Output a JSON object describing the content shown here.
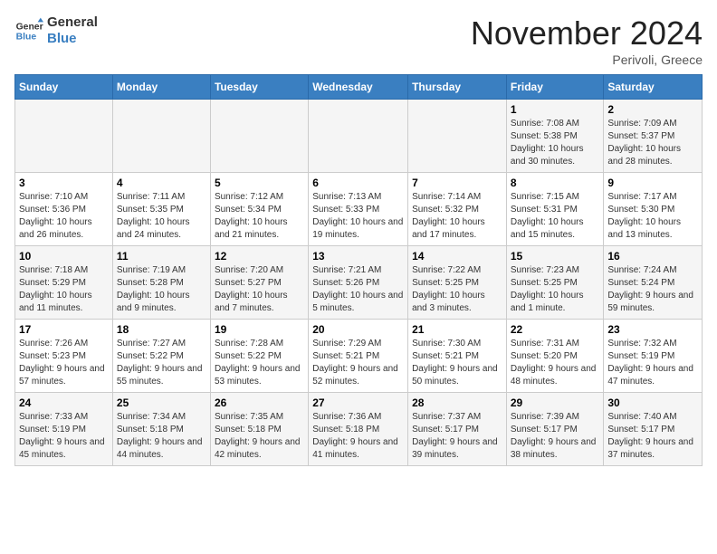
{
  "header": {
    "logo_line1": "General",
    "logo_line2": "Blue",
    "month": "November 2024",
    "location": "Perivoli, Greece"
  },
  "weekdays": [
    "Sunday",
    "Monday",
    "Tuesday",
    "Wednesday",
    "Thursday",
    "Friday",
    "Saturday"
  ],
  "weeks": [
    [
      {
        "day": "",
        "info": ""
      },
      {
        "day": "",
        "info": ""
      },
      {
        "day": "",
        "info": ""
      },
      {
        "day": "",
        "info": ""
      },
      {
        "day": "",
        "info": ""
      },
      {
        "day": "1",
        "info": "Sunrise: 7:08 AM\nSunset: 5:38 PM\nDaylight: 10 hours and 30 minutes."
      },
      {
        "day": "2",
        "info": "Sunrise: 7:09 AM\nSunset: 5:37 PM\nDaylight: 10 hours and 28 minutes."
      }
    ],
    [
      {
        "day": "3",
        "info": "Sunrise: 7:10 AM\nSunset: 5:36 PM\nDaylight: 10 hours and 26 minutes."
      },
      {
        "day": "4",
        "info": "Sunrise: 7:11 AM\nSunset: 5:35 PM\nDaylight: 10 hours and 24 minutes."
      },
      {
        "day": "5",
        "info": "Sunrise: 7:12 AM\nSunset: 5:34 PM\nDaylight: 10 hours and 21 minutes."
      },
      {
        "day": "6",
        "info": "Sunrise: 7:13 AM\nSunset: 5:33 PM\nDaylight: 10 hours and 19 minutes."
      },
      {
        "day": "7",
        "info": "Sunrise: 7:14 AM\nSunset: 5:32 PM\nDaylight: 10 hours and 17 minutes."
      },
      {
        "day": "8",
        "info": "Sunrise: 7:15 AM\nSunset: 5:31 PM\nDaylight: 10 hours and 15 minutes."
      },
      {
        "day": "9",
        "info": "Sunrise: 7:17 AM\nSunset: 5:30 PM\nDaylight: 10 hours and 13 minutes."
      }
    ],
    [
      {
        "day": "10",
        "info": "Sunrise: 7:18 AM\nSunset: 5:29 PM\nDaylight: 10 hours and 11 minutes."
      },
      {
        "day": "11",
        "info": "Sunrise: 7:19 AM\nSunset: 5:28 PM\nDaylight: 10 hours and 9 minutes."
      },
      {
        "day": "12",
        "info": "Sunrise: 7:20 AM\nSunset: 5:27 PM\nDaylight: 10 hours and 7 minutes."
      },
      {
        "day": "13",
        "info": "Sunrise: 7:21 AM\nSunset: 5:26 PM\nDaylight: 10 hours and 5 minutes."
      },
      {
        "day": "14",
        "info": "Sunrise: 7:22 AM\nSunset: 5:25 PM\nDaylight: 10 hours and 3 minutes."
      },
      {
        "day": "15",
        "info": "Sunrise: 7:23 AM\nSunset: 5:25 PM\nDaylight: 10 hours and 1 minute."
      },
      {
        "day": "16",
        "info": "Sunrise: 7:24 AM\nSunset: 5:24 PM\nDaylight: 9 hours and 59 minutes."
      }
    ],
    [
      {
        "day": "17",
        "info": "Sunrise: 7:26 AM\nSunset: 5:23 PM\nDaylight: 9 hours and 57 minutes."
      },
      {
        "day": "18",
        "info": "Sunrise: 7:27 AM\nSunset: 5:22 PM\nDaylight: 9 hours and 55 minutes."
      },
      {
        "day": "19",
        "info": "Sunrise: 7:28 AM\nSunset: 5:22 PM\nDaylight: 9 hours and 53 minutes."
      },
      {
        "day": "20",
        "info": "Sunrise: 7:29 AM\nSunset: 5:21 PM\nDaylight: 9 hours and 52 minutes."
      },
      {
        "day": "21",
        "info": "Sunrise: 7:30 AM\nSunset: 5:21 PM\nDaylight: 9 hours and 50 minutes."
      },
      {
        "day": "22",
        "info": "Sunrise: 7:31 AM\nSunset: 5:20 PM\nDaylight: 9 hours and 48 minutes."
      },
      {
        "day": "23",
        "info": "Sunrise: 7:32 AM\nSunset: 5:19 PM\nDaylight: 9 hours and 47 minutes."
      }
    ],
    [
      {
        "day": "24",
        "info": "Sunrise: 7:33 AM\nSunset: 5:19 PM\nDaylight: 9 hours and 45 minutes."
      },
      {
        "day": "25",
        "info": "Sunrise: 7:34 AM\nSunset: 5:18 PM\nDaylight: 9 hours and 44 minutes."
      },
      {
        "day": "26",
        "info": "Sunrise: 7:35 AM\nSunset: 5:18 PM\nDaylight: 9 hours and 42 minutes."
      },
      {
        "day": "27",
        "info": "Sunrise: 7:36 AM\nSunset: 5:18 PM\nDaylight: 9 hours and 41 minutes."
      },
      {
        "day": "28",
        "info": "Sunrise: 7:37 AM\nSunset: 5:17 PM\nDaylight: 9 hours and 39 minutes."
      },
      {
        "day": "29",
        "info": "Sunrise: 7:39 AM\nSunset: 5:17 PM\nDaylight: 9 hours and 38 minutes."
      },
      {
        "day": "30",
        "info": "Sunrise: 7:40 AM\nSunset: 5:17 PM\nDaylight: 9 hours and 37 minutes."
      }
    ]
  ]
}
